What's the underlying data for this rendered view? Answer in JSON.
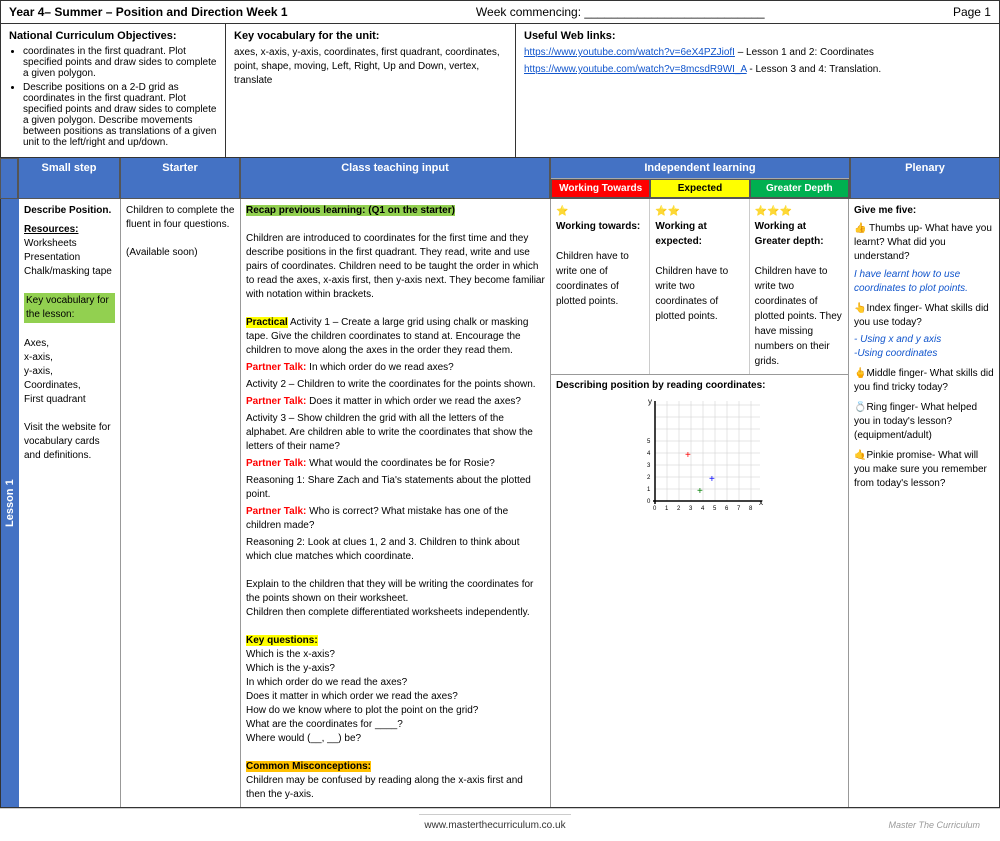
{
  "header": {
    "title": "Year 4– Summer – Position and Direction Week 1",
    "week_commencing": "Week commencing: ___________________________",
    "page": "Page 1"
  },
  "objectives": {
    "heading": "National Curriculum Objectives:",
    "items": [
      "coordinates in the first quadrant. Plot specified points and draw sides to complete a given polygon.",
      "Describe positions on a 2-D grid as coordinates in the first quadrant. Plot specified points and draw sides to complete a given polygon. Describe movements between positions as translations of a given unit to the left/right and up/down."
    ]
  },
  "key_vocab_unit": {
    "heading": "Key vocabulary for the unit:",
    "content": "axes, x-axis, y-axis, coordinates, first quadrant, coordinates, point, shape, moving, Left, Right, Up and Down, vertex, translate"
  },
  "web_links": {
    "heading": "Useful Web links:",
    "links": [
      {
        "url": "https://www.youtube.com/watch?v=6eX4PZJiofI",
        "label": "https://www.youtube.com/watch?v=6eX4PZJiofI",
        "suffix": " – Lesson 1 and 2: Coordinates"
      },
      {
        "url": "https://www.youtube.com/watch?v=8mcsdR9WI_A",
        "label": "https://www.youtube.com/watch?v=8mcsdR9WI_A",
        "suffix": " - Lesson 3 and 4: Translation."
      }
    ]
  },
  "column_headers": {
    "small_step": "Small step",
    "starter": "Starter",
    "teaching": "Class teaching input",
    "independent": "Independent learning",
    "plenary": "Plenary"
  },
  "independent_sub_headers": {
    "towards": "Working Towards",
    "expected": "Expected",
    "greater": "Greater Depth"
  },
  "lesson1": {
    "label": "Lesson 1",
    "small_step": {
      "heading": "Describe Position.",
      "resources_label": "Resources:",
      "resources": [
        "Worksheets",
        "Presentation",
        "Chalk/masking tape"
      ],
      "vocab_label": "Key vocabulary for the lesson:",
      "vocab_items": [
        "Axes,",
        "x-axis,",
        "y-axis,",
        "Coordinates,",
        "First quadrant"
      ],
      "website_note": "Visit the website for vocabulary cards and definitions."
    },
    "starter": {
      "text": "Children to complete the fluent in four questions.",
      "available": "(Available soon)"
    },
    "teaching": {
      "recap": "Recap previous learning: (Q1 on the starter)",
      "intro": "Children are introduced to coordinates for the first time and they describe positions in the first quadrant. They read, write and use pairs of coordinates. Children need to be taught the order in which to read the axes, x-axis first, then y-axis next. They become familiar with notation within brackets.",
      "activities": [
        {
          "type": "practical",
          "label": "Practical",
          "text": " Activity 1 – Create a large grid using chalk or masking tape. Give the children coordinates to stand at. Encourage the children to move along the axes in the order they read them."
        },
        {
          "type": "partner",
          "label": "Partner Talk:",
          "text": " In which order do we read axes?"
        },
        {
          "type": "normal",
          "text": "Activity 2 – Children to write the coordinates for the points shown."
        },
        {
          "type": "partner",
          "label": "Partner Talk:",
          "text": " Does it matter in which order we read the axes?"
        },
        {
          "type": "normal",
          "text": "Activity 3 – Show children the grid with all the letters of the alphabet. Are children able to write the coordinates that show the letters of their name?"
        },
        {
          "type": "partner",
          "label": "Partner Talk:",
          "text": " What would the coordinates be for Rosie?"
        },
        {
          "type": "normal",
          "text": "Reasoning 1: Share Zach and Tia's statements about the plotted point."
        },
        {
          "type": "partner",
          "label": "Partner Talk:",
          "text": " Who is correct? What mistake has one of the children made?"
        },
        {
          "type": "normal",
          "text": "Reasoning 2: Look at clues 1, 2 and 3. Children to think about which clue matches which coordinate."
        }
      ],
      "explain": "Explain to the children that they will be writing the coordinates for the points shown on their worksheet.",
      "independent": "Children then complete differentiated worksheets independently.",
      "key_questions_label": "Key questions:",
      "key_questions": [
        "Which is the x-axis?",
        "Which is the y-axis?",
        "In which order do we read the axes?",
        "Does it matter in which order we read the axes?",
        "How do we know where to plot the point on the grid?",
        "What are the coordinates for ____?",
        "Where would (__, __) be?"
      ],
      "misconceptions_label": "Common Misconceptions:",
      "misconceptions": "Children may be confused by reading along the x-axis first and then the y-axis."
    },
    "independent": {
      "towards": {
        "stars": "⭐",
        "label": "Working towards:",
        "text": "Children have to write one of coordinates of plotted points."
      },
      "expected": {
        "stars": "⭐⭐",
        "label": "Working at expected:",
        "text": "Children have to write two coordinates of plotted points."
      },
      "greater": {
        "stars": "⭐⭐⭐",
        "label": "Working at Greater depth:",
        "text": "Children have to write two coordinates of plotted points. They have missing numbers on their grids."
      },
      "bottom_label": "Describing position by reading coordinates:"
    },
    "plenary": {
      "intro": "Give me five:",
      "thumbs": "👍 Thumbs up- What have you learnt? What did you understand?",
      "have_learnt": "I have learnt how to use coordinates to plot points.",
      "index": "👆Index finger- What skills did you use today?",
      "skills_1": "- Using x and y axis",
      "skills_2": "-Using coordinates",
      "middle": "🖕Middle finger- What skills did you find tricky today?",
      "ring": "💍Ring finger- What helped you in today's lesson? (equipment/adult)",
      "pinkie": "🤙Pinkie promise- What will you make sure you remember from today's lesson?"
    }
  },
  "footer": {
    "website": "www.masterthecurriculum.co.uk",
    "brand": "Master The Curriculum"
  }
}
